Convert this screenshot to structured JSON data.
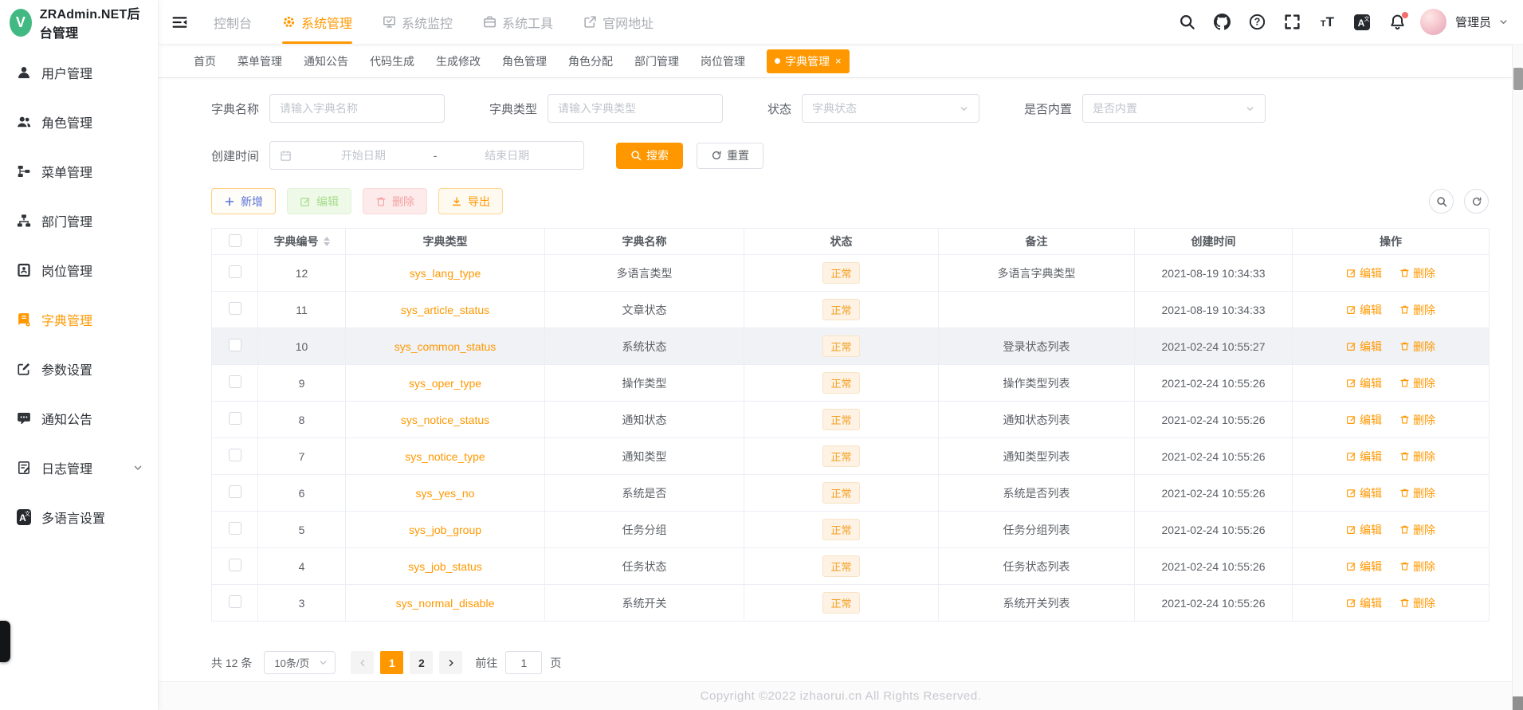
{
  "colors": {
    "accent": "#ff9800",
    "logo": "#42b983",
    "link": "#ff9800",
    "badge": "#f56c6c",
    "add_text": "#5a73d7",
    "add_border": "#ffcc80",
    "success_bg": "#eef9e8",
    "success_text": "#a8dd8c",
    "success_border": "#e1f3d8",
    "danger_bg": "#fdeaea",
    "danger_text": "#f3a3a3",
    "danger_border": "#fbd9d9",
    "export_bg": "#fffaf0",
    "export_text": "#ff9800",
    "export_border": "#ffd591",
    "tag_bg": "#fdf2e3",
    "tag_text": "#f59f22",
    "tag_border": "#f8e3c5"
  },
  "brand": {
    "logo_letter": "V",
    "title": "ZRAdmin.NET后台管理"
  },
  "header": {
    "nav": [
      {
        "label": "控制台",
        "icon": "",
        "active": false
      },
      {
        "label": "系统管理",
        "icon": "gear",
        "active": true
      },
      {
        "label": "系统监控",
        "icon": "monitor",
        "active": false
      },
      {
        "label": "系统工具",
        "icon": "toolbox",
        "active": false
      },
      {
        "label": "官网地址",
        "icon": "extlink",
        "active": false
      }
    ],
    "icons": [
      {
        "name": "search-icon",
        "icon": "search",
        "badge": false
      },
      {
        "name": "github-icon",
        "icon": "github",
        "badge": false
      },
      {
        "name": "help-icon",
        "icon": "question",
        "badge": false
      },
      {
        "name": "fullscreen-icon",
        "icon": "fullscreen",
        "badge": false
      },
      {
        "name": "font-size-icon",
        "icon": "fontsize",
        "badge": false
      },
      {
        "name": "language-icon",
        "icon": "language",
        "badge": false
      },
      {
        "name": "notification-bell-icon",
        "icon": "bell",
        "badge": true
      }
    ],
    "user": {
      "name": "管理员"
    }
  },
  "sidebar": {
    "items": [
      {
        "label": "用户管理",
        "icon": "user",
        "active": false,
        "expandable": false
      },
      {
        "label": "角色管理",
        "icon": "users",
        "active": false,
        "expandable": false
      },
      {
        "label": "菜单管理",
        "icon": "menutree",
        "active": false,
        "expandable": false
      },
      {
        "label": "部门管理",
        "icon": "dept",
        "active": false,
        "expandable": false
      },
      {
        "label": "岗位管理",
        "icon": "post",
        "active": false,
        "expandable": false
      },
      {
        "label": "字典管理",
        "icon": "dict",
        "active": true,
        "expandable": false
      },
      {
        "label": "参数设置",
        "icon": "param",
        "active": false,
        "expandable": false
      },
      {
        "label": "通知公告",
        "icon": "notice",
        "active": false,
        "expandable": false
      },
      {
        "label": "日志管理",
        "icon": "log",
        "active": false,
        "expandable": true
      },
      {
        "label": "多语言设置",
        "icon": "language",
        "active": false,
        "expandable": false
      }
    ]
  },
  "tabbar": {
    "close_glyph": "×",
    "tabs": [
      {
        "label": "首页",
        "active": false,
        "closable": false
      },
      {
        "label": "菜单管理",
        "active": false,
        "closable": false
      },
      {
        "label": "通知公告",
        "active": false,
        "closable": false
      },
      {
        "label": "代码生成",
        "active": false,
        "closable": false
      },
      {
        "label": "生成修改",
        "active": false,
        "closable": false
      },
      {
        "label": "角色管理",
        "active": false,
        "closable": false
      },
      {
        "label": "角色分配",
        "active": false,
        "closable": false
      },
      {
        "label": "部门管理",
        "active": false,
        "closable": false
      },
      {
        "label": "岗位管理",
        "active": false,
        "closable": false
      },
      {
        "label": "字典管理",
        "active": true,
        "closable": true
      }
    ]
  },
  "filters": {
    "name_label": "字典名称",
    "name_placeholder": "请输入字典名称",
    "type_label": "字典类型",
    "type_placeholder": "请输入字典类型",
    "status_label": "状态",
    "status_placeholder": "字典状态",
    "builtin_label": "是否内置",
    "builtin_placeholder": "是否内置",
    "date_label": "创建时间",
    "date_start_placeholder": "开始日期",
    "date_separator": "-",
    "date_end_placeholder": "结束日期",
    "search_label": "搜索",
    "reset_label": "重置"
  },
  "toolbar": {
    "add_label": "新增",
    "edit_label": "编辑",
    "delete_label": "删除",
    "export_label": "导出"
  },
  "table": {
    "columns": [
      {
        "label": "字典编号",
        "sortable": true
      },
      {
        "label": "字典类型",
        "sortable": false
      },
      {
        "label": "字典名称",
        "sortable": false
      },
      {
        "label": "状态",
        "sortable": false
      },
      {
        "label": "备注",
        "sortable": false
      },
      {
        "label": "创建时间",
        "sortable": false
      },
      {
        "label": "操作",
        "sortable": false
      }
    ],
    "edit_label": "编辑",
    "delete_label": "删除",
    "rows": [
      {
        "id": "12",
        "type": "sys_lang_type",
        "name": "多语言类型",
        "status": "正常",
        "remark": "多语言字典类型",
        "created": "2021-08-19 10:34:33",
        "highlight": false
      },
      {
        "id": "11",
        "type": "sys_article_status",
        "name": "文章状态",
        "status": "正常",
        "remark": "",
        "created": "2021-08-19 10:34:33",
        "highlight": false
      },
      {
        "id": "10",
        "type": "sys_common_status",
        "name": "系统状态",
        "status": "正常",
        "remark": "登录状态列表",
        "created": "2021-02-24 10:55:27",
        "highlight": true
      },
      {
        "id": "9",
        "type": "sys_oper_type",
        "name": "操作类型",
        "status": "正常",
        "remark": "操作类型列表",
        "created": "2021-02-24 10:55:26",
        "highlight": false
      },
      {
        "id": "8",
        "type": "sys_notice_status",
        "name": "通知状态",
        "status": "正常",
        "remark": "通知状态列表",
        "created": "2021-02-24 10:55:26",
        "highlight": false
      },
      {
        "id": "7",
        "type": "sys_notice_type",
        "name": "通知类型",
        "status": "正常",
        "remark": "通知类型列表",
        "created": "2021-02-24 10:55:26",
        "highlight": false
      },
      {
        "id": "6",
        "type": "sys_yes_no",
        "name": "系统是否",
        "status": "正常",
        "remark": "系统是否列表",
        "created": "2021-02-24 10:55:26",
        "highlight": false
      },
      {
        "id": "5",
        "type": "sys_job_group",
        "name": "任务分组",
        "status": "正常",
        "remark": "任务分组列表",
        "created": "2021-02-24 10:55:26",
        "highlight": false
      },
      {
        "id": "4",
        "type": "sys_job_status",
        "name": "任务状态",
        "status": "正常",
        "remark": "任务状态列表",
        "created": "2021-02-24 10:55:26",
        "highlight": false
      },
      {
        "id": "3",
        "type": "sys_normal_disable",
        "name": "系统开关",
        "status": "正常",
        "remark": "系统开关列表",
        "created": "2021-02-24 10:55:26",
        "highlight": false
      }
    ]
  },
  "pagination": {
    "total": "共 12 条",
    "page_size": "10条/页",
    "pages": [
      {
        "label": "1",
        "active": true
      },
      {
        "label": "2",
        "active": false
      }
    ],
    "goto_label": "前往",
    "goto_value": "1",
    "unit_label": "页"
  },
  "footer": {
    "copyright": "Copyright ©2022 izhaorui.cn All Rights Reserved."
  }
}
